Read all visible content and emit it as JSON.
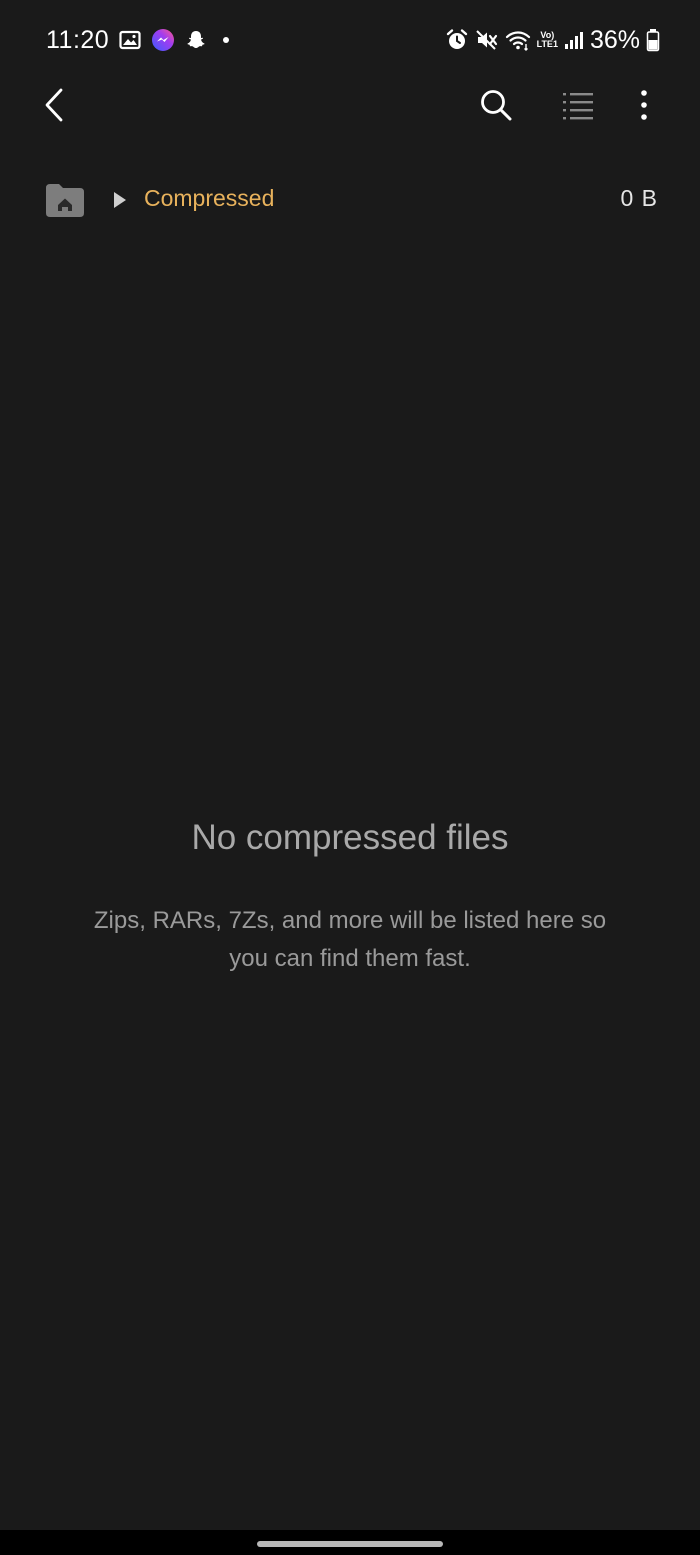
{
  "status_bar": {
    "time": "11:20",
    "battery_percent": "36%",
    "left_icons": [
      "gallery-icon",
      "messenger-icon",
      "snapchat-icon",
      "notification-dot"
    ],
    "right_icons": [
      "alarm-icon",
      "mute-icon",
      "wifi-icon",
      "volte-icon",
      "signal-icon",
      "battery-icon"
    ],
    "volte_line1": "Vo)",
    "volte_line2": "LTE1"
  },
  "toolbar": {
    "back_icon": "back-arrow-icon",
    "search_icon": "search-icon",
    "list_icon": "list-view-icon",
    "more_icon": "more-vertical-icon"
  },
  "breadcrumb": {
    "home_icon": "home-folder-icon",
    "separator_icon": "play-arrow-icon",
    "current_folder": "Compressed",
    "size": "0 B",
    "accent_color": "#e8b25c"
  },
  "empty_state": {
    "title": "No compressed files",
    "description": "Zips, RARs, 7Zs, and more will be listed here so you can find them fast."
  },
  "theme": {
    "background": "#1a1a1a",
    "muted_text": "#a9a9a9"
  }
}
